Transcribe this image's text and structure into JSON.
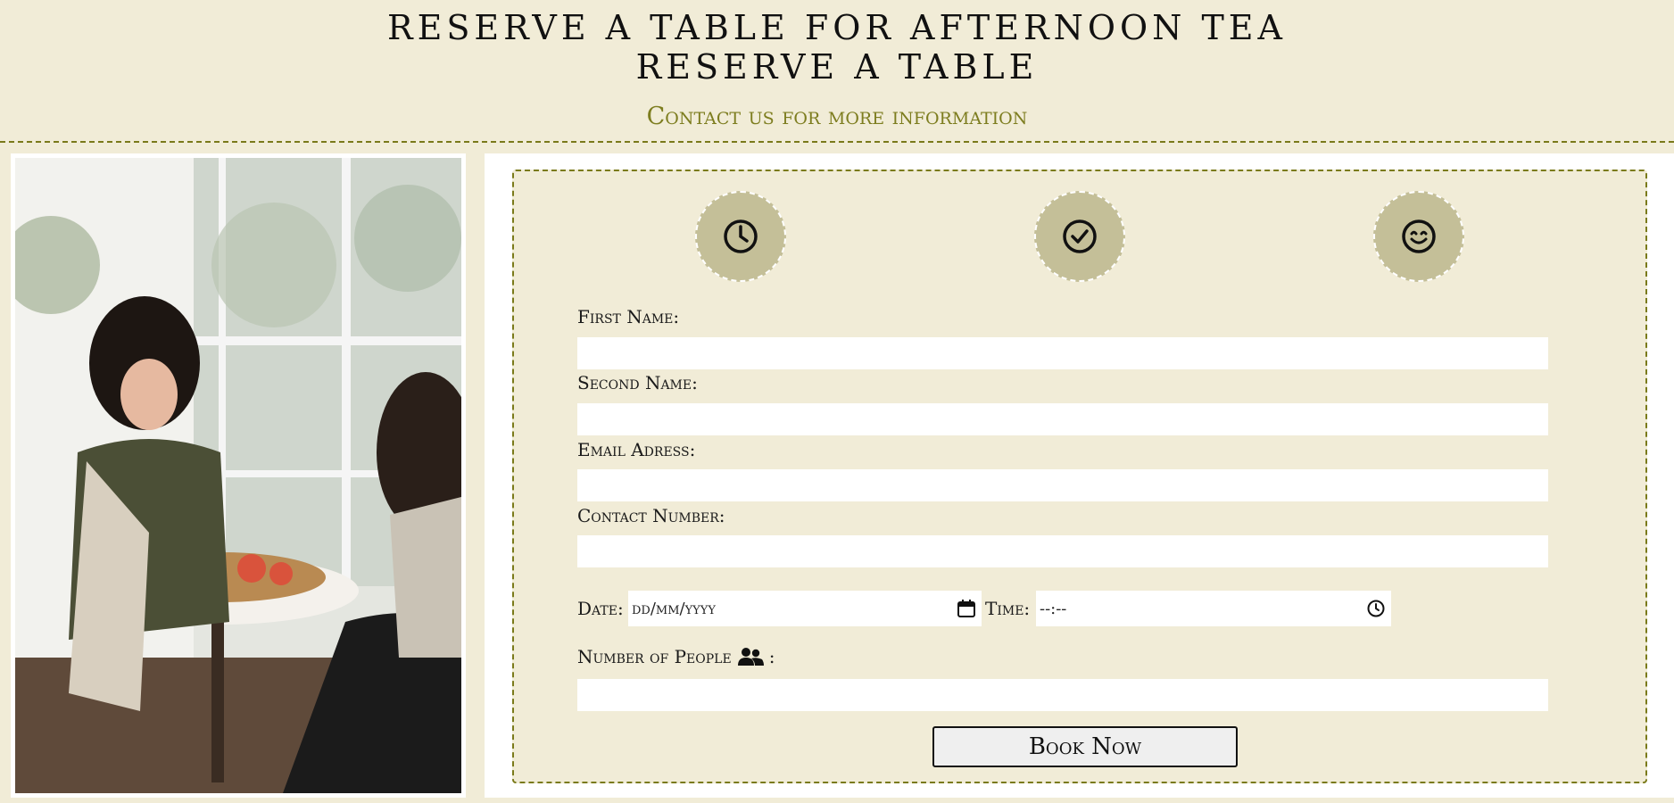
{
  "header": {
    "title_line1": "RESERVE A TABLE FOR AFTERNOON TEA",
    "title_line2": "RESERVE A TABLE",
    "subtitle": "Contact us for more information"
  },
  "icons": [
    "clock-icon",
    "check-circle-icon",
    "smile-icon"
  ],
  "form": {
    "first_name_label": "First Name:",
    "second_name_label": "Second Name:",
    "email_label": "Email Adress:",
    "contact_label": "Contact Number:",
    "date_label": "Date:",
    "date_placeholder": "dd/mm/yyyy",
    "time_label": "Time:",
    "time_placeholder": "--:--",
    "people_label": "Number of People",
    "people_suffix": ":",
    "submit_label": "Book Now"
  },
  "colors": {
    "background": "#f1ecd7",
    "accent": "#7d7d1f",
    "icon_circle": "#c4bf98"
  }
}
